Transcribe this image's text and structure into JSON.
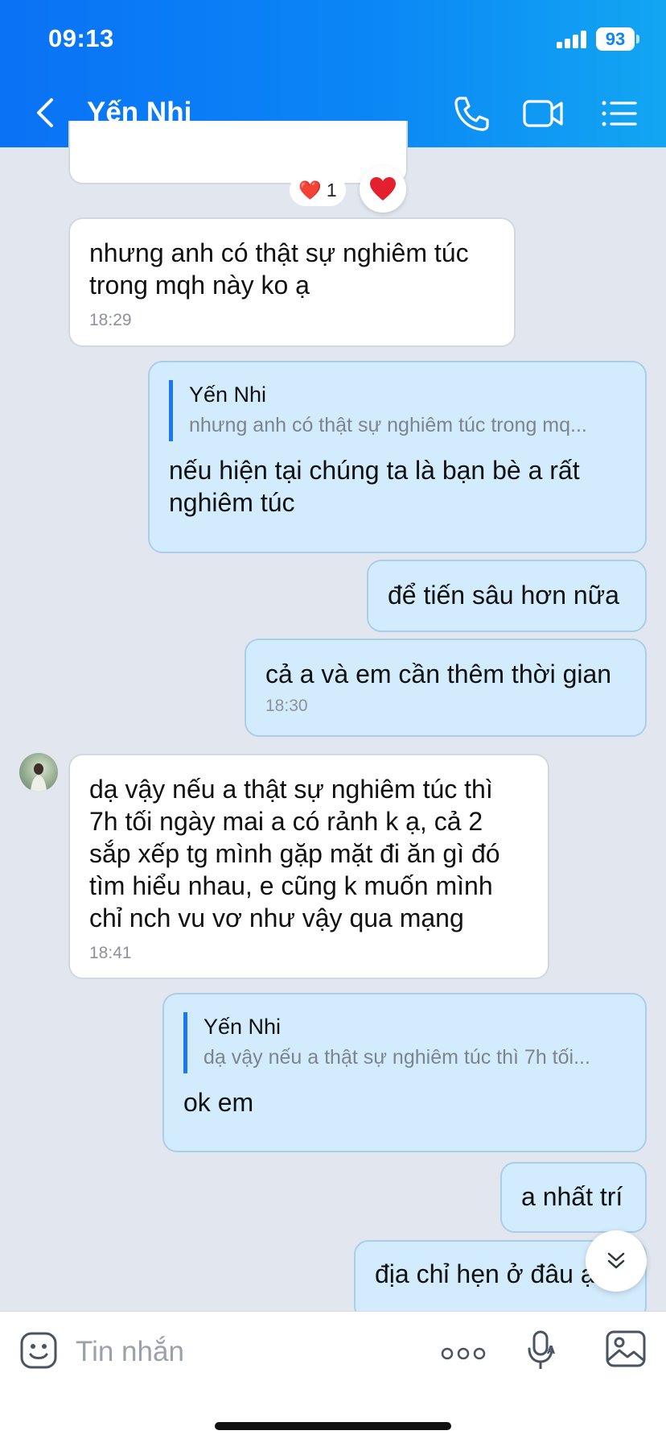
{
  "status_bar": {
    "time": "09:13",
    "battery": "93"
  },
  "header": {
    "title": "Yến Nhi"
  },
  "reaction": {
    "emoji": "❤️",
    "count": "1"
  },
  "messages": [
    {
      "text": "nhưng anh có thật sự nghiêm túc trong mqh này ko ạ",
      "time": "18:29"
    },
    {
      "quote_author": "Yến Nhi",
      "quote_text": "nhưng anh có thật sự nghiêm túc trong mq...",
      "text": "nếu hiện tại chúng ta là bạn bè a rất nghiêm túc"
    },
    {
      "text": "để tiến sâu hơn nữa"
    },
    {
      "text": "cả a và em cần thêm thời gian",
      "time": "18:30"
    },
    {
      "text": "dạ vậy nếu a thật sự nghiêm túc thì 7h tối ngày mai  a có rảnh k ạ, cả 2 sắp xếp tg mình gặp mặt đi ăn gì đó tìm hiểu nhau, e cũng k muốn mình chỉ nch vu vơ như vậy qua mạng",
      "time": "18:41"
    },
    {
      "quote_author": "Yến Nhi",
      "quote_text": "dạ vậy nếu a thật sự nghiêm túc thì 7h tối...",
      "text": "ok em"
    },
    {
      "text": "a nhất trí"
    },
    {
      "text": "địa chỉ hẹn ở đâu ạ"
    }
  ],
  "composer": {
    "placeholder": "Tin nhắn"
  },
  "colors": {
    "accent": "#0b86f6",
    "outgoing_bubble": "#d3ecfd",
    "incoming_bubble": "#ffffff",
    "background": "#e2e7ef"
  }
}
